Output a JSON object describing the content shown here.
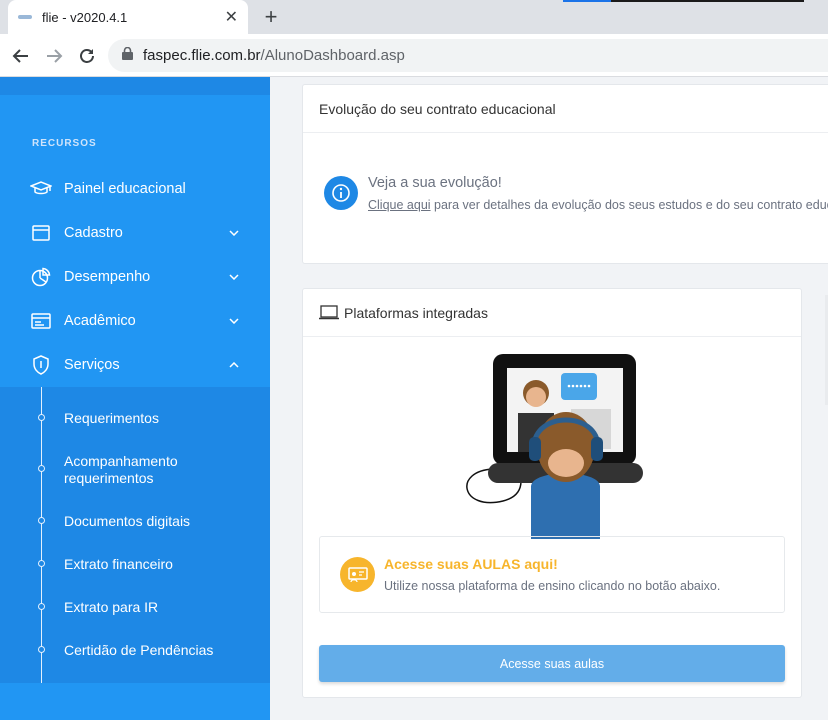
{
  "browser": {
    "tab_title": "flie - v2020.4.1",
    "tab_close": "✕",
    "new_tab": "+",
    "url_domain": "faspec.flie.com.br",
    "url_path": "/AlunoDashboard.asp"
  },
  "sidebar": {
    "section_label": "RECURSOS",
    "items": [
      {
        "label": "Painel educacional",
        "icon": "graduation-cap-icon"
      },
      {
        "label": "Cadastro",
        "icon": "window-icon"
      },
      {
        "label": "Desempenho",
        "icon": "pie-chart-icon"
      },
      {
        "label": "Acadêmico",
        "icon": "id-card-icon"
      },
      {
        "label": "Serviços",
        "icon": "shield-icon"
      }
    ],
    "submenu": [
      "Requerimentos",
      "Acompanhamento requerimentos",
      "Documentos digitais",
      "Extrato financeiro",
      "Extrato para IR",
      "Certidão de Pendências"
    ]
  },
  "contract_card": {
    "title": "Evolução do seu contrato educacional",
    "heading": "Veja a sua evolução!",
    "link_text": "Clique aqui",
    "description": " para ver detalhes da evolução dos seus estudos e do seu contrato educacional."
  },
  "platforms_card": {
    "title": "Plataformas integradas",
    "notice_title": "Acesse suas AULAS aqui!",
    "notice_text": "Utilize nossa plataforma de ensino clicando no botão abaixo.",
    "button_label": "Acesse suas aulas"
  },
  "colors": {
    "sidebar": "#2196f3",
    "submenu": "#1e88e5",
    "accent_orange": "#f7b52c",
    "button": "#63ade9"
  }
}
